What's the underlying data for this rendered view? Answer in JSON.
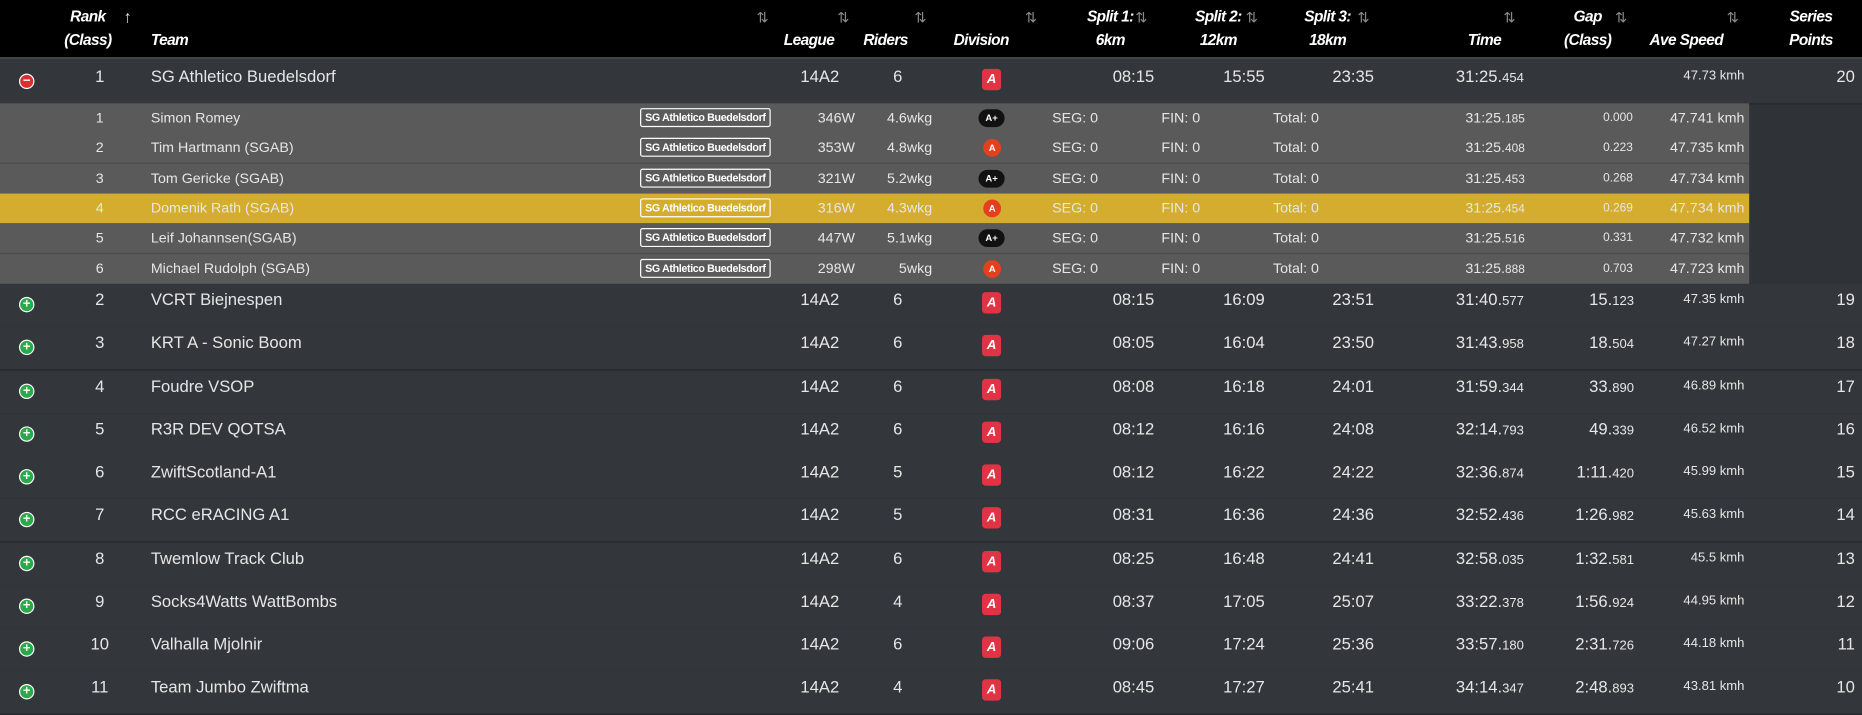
{
  "header": {
    "rank_l1": "Rank",
    "rank_l2": "(Class)",
    "team": "Team",
    "league": "League",
    "riders": "Riders",
    "division": "Division",
    "split1_l1": "Split 1:",
    "split1_l2": "6km",
    "split2_l1": "Split 2:",
    "split2_l2": "12km",
    "split3_l1": "Split 3:",
    "split3_l2": "18km",
    "time": "Time",
    "gap_l1": "Gap",
    "gap_l2": "(Class)",
    "ave_speed": "Ave Speed",
    "points_l1": "Series",
    "points_l2": "Points",
    "sort_icon": "⇅",
    "sort_active_icon": "↑"
  },
  "expanded_team": {
    "toggle": "−",
    "rank": "1",
    "team": "SG Athletico Buedelsdorf",
    "league": "14A2",
    "riders": "6",
    "division": "A",
    "split1": "08:15",
    "split2": "15:55",
    "split3": "23:35",
    "time_main": "31:25.",
    "time_ms": "454",
    "gap_main": "",
    "gap_ms": "",
    "speed": "47.73 kmh",
    "points": "20"
  },
  "riders": [
    {
      "pos": "1",
      "name": "Simon Romey",
      "team_tag": "SG Athletico Buedelsdorf",
      "watts": "346W",
      "wkg": "4.6wkg",
      "cat": "A+",
      "seg": "SEG: 0",
      "fin": "FIN: 0",
      "total": "Total: 0",
      "time_main": "31:25.",
      "time_ms": "185",
      "gap": "0.000",
      "speed": "47.741 kmh",
      "highlight": false
    },
    {
      "pos": "2",
      "name": "Tim Hartmann (SGAB)",
      "team_tag": "SG Athletico Buedelsdorf",
      "watts": "353W",
      "wkg": "4.8wkg",
      "cat": "A",
      "seg": "SEG: 0",
      "fin": "FIN: 0",
      "total": "Total: 0",
      "time_main": "31:25.",
      "time_ms": "408",
      "gap": "0.223",
      "speed": "47.735 kmh",
      "highlight": false
    },
    {
      "pos": "3",
      "name": "Tom Gericke (SGAB)",
      "team_tag": "SG Athletico Buedelsdorf",
      "watts": "321W",
      "wkg": "5.2wkg",
      "cat": "A+",
      "seg": "SEG: 0",
      "fin": "FIN: 0",
      "total": "Total: 0",
      "time_main": "31:25.",
      "time_ms": "453",
      "gap": "0.268",
      "speed": "47.734 kmh",
      "highlight": false
    },
    {
      "pos": "4",
      "name": "Domenik Rath (SGAB)",
      "team_tag": "SG Athletico Buedelsdorf",
      "watts": "316W",
      "wkg": "4.3wkg",
      "cat": "A",
      "seg": "SEG: 0",
      "fin": "FIN: 0",
      "total": "Total: 0",
      "time_main": "31:25.",
      "time_ms": "454",
      "gap": "0.269",
      "speed": "47.734 kmh",
      "highlight": true
    },
    {
      "pos": "5",
      "name": "Leif Johannsen(SGAB)",
      "team_tag": "SG Athletico Buedelsdorf",
      "watts": "447W",
      "wkg": "5.1wkg",
      "cat": "A+",
      "seg": "SEG: 0",
      "fin": "FIN: 0",
      "total": "Total: 0",
      "time_main": "31:25.",
      "time_ms": "516",
      "gap": "0.331",
      "speed": "47.732 kmh",
      "highlight": false
    },
    {
      "pos": "6",
      "name": "Michael Rudolph (SGAB)",
      "team_tag": "SG Athletico Buedelsdorf",
      "watts": "298W",
      "wkg": "5wkg",
      "cat": "A",
      "seg": "SEG: 0",
      "fin": "FIN: 0",
      "total": "Total: 0",
      "time_main": "31:25.",
      "time_ms": "888",
      "gap": "0.703",
      "speed": "47.723 kmh",
      "highlight": false
    }
  ],
  "teams": [
    {
      "rank": "2",
      "team": "VCRT Biejnespen",
      "league": "14A2",
      "riders": "6",
      "division": "A",
      "split1": "08:15",
      "split2": "16:09",
      "split3": "23:51",
      "time_main": "31:40.",
      "time_ms": "577",
      "gap_main": "15.",
      "gap_ms": "123",
      "speed": "47.35 kmh",
      "points": "19"
    },
    {
      "rank": "3",
      "team": "KRT A - Sonic Boom",
      "league": "14A2",
      "riders": "6",
      "division": "A",
      "split1": "08:05",
      "split2": "16:04",
      "split3": "23:50",
      "time_main": "31:43.",
      "time_ms": "958",
      "gap_main": "18.",
      "gap_ms": "504",
      "speed": "47.27 kmh",
      "points": "18"
    },
    {
      "rank": "4",
      "team": "Foudre VSOP",
      "league": "14A2",
      "riders": "6",
      "division": "A",
      "split1": "08:08",
      "split2": "16:18",
      "split3": "24:01",
      "time_main": "31:59.",
      "time_ms": "344",
      "gap_main": "33.",
      "gap_ms": "890",
      "speed": "46.89 kmh",
      "points": "17"
    },
    {
      "rank": "5",
      "team": "R3R DEV QOTSA",
      "league": "14A2",
      "riders": "6",
      "division": "A",
      "split1": "08:12",
      "split2": "16:16",
      "split3": "24:08",
      "time_main": "32:14.",
      "time_ms": "793",
      "gap_main": "49.",
      "gap_ms": "339",
      "speed": "46.52 kmh",
      "points": "16"
    },
    {
      "rank": "6",
      "team": "ZwiftScotland-A1",
      "league": "14A2",
      "riders": "5",
      "division": "A",
      "split1": "08:12",
      "split2": "16:22",
      "split3": "24:22",
      "time_main": "32:36.",
      "time_ms": "874",
      "gap_main": "1:11.",
      "gap_ms": "420",
      "speed": "45.99 kmh",
      "points": "15"
    },
    {
      "rank": "7",
      "team": "RCC eRACING A1",
      "league": "14A2",
      "riders": "5",
      "division": "A",
      "split1": "08:31",
      "split2": "16:36",
      "split3": "24:36",
      "time_main": "32:52.",
      "time_ms": "436",
      "gap_main": "1:26.",
      "gap_ms": "982",
      "speed": "45.63 kmh",
      "points": "14"
    },
    {
      "rank": "8",
      "team": "Twemlow Track Club",
      "league": "14A2",
      "riders": "6",
      "division": "A",
      "split1": "08:25",
      "split2": "16:48",
      "split3": "24:41",
      "time_main": "32:58.",
      "time_ms": "035",
      "gap_main": "1:32.",
      "gap_ms": "581",
      "speed": "45.5 kmh",
      "points": "13"
    },
    {
      "rank": "9",
      "team": "Socks4Watts WattBombs",
      "league": "14A2",
      "riders": "4",
      "division": "A",
      "split1": "08:37",
      "split2": "17:05",
      "split3": "25:07",
      "time_main": "33:22.",
      "time_ms": "378",
      "gap_main": "1:56.",
      "gap_ms": "924",
      "speed": "44.95 kmh",
      "points": "12"
    },
    {
      "rank": "10",
      "team": "Valhalla Mjolnir",
      "league": "14A2",
      "riders": "6",
      "division": "A",
      "split1": "09:06",
      "split2": "17:24",
      "split3": "25:36",
      "time_main": "33:57.",
      "time_ms": "180",
      "gap_main": "2:31.",
      "gap_ms": "726",
      "speed": "44.18 kmh",
      "points": "11"
    },
    {
      "rank": "11",
      "team": "Team Jumbo Zwiftma",
      "league": "14A2",
      "riders": "4",
      "division": "A",
      "split1": "08:45",
      "split2": "17:27",
      "split3": "25:41",
      "time_main": "34:14.",
      "time_ms": "347",
      "gap_main": "2:48.",
      "gap_ms": "893",
      "speed": "43.81 kmh",
      "points": "10"
    }
  ],
  "expand_icon": "+",
  "colors": {
    "header_bg": "#000000",
    "row_bg": "#33363b",
    "rider_bg": "#5a5a5a",
    "highlight": "#d4ac2e",
    "division_badge": "#e03444",
    "expand_green": "#2aa84a",
    "collapse_red": "#d8302f"
  }
}
